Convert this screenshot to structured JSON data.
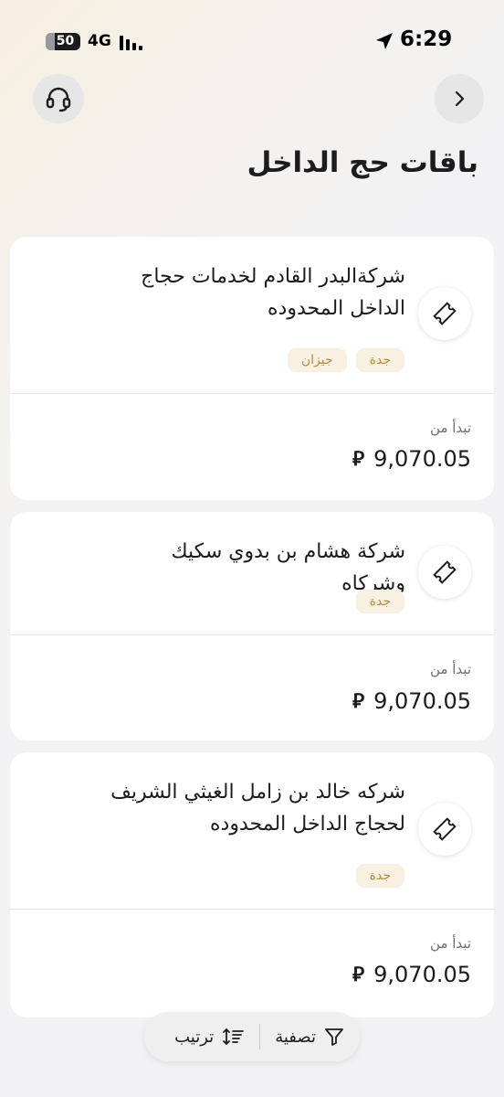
{
  "status_bar": {
    "time": "6:29",
    "battery": "50",
    "network": "4G",
    "icons": [
      "location-arrow-icon",
      "signal-bars-icon",
      "battery-icon"
    ]
  },
  "header": {
    "title": "باقات حج الداخل",
    "back_icon": "chevron-right-icon",
    "support_icon": "headset-icon"
  },
  "cards": [
    {
      "name": "شركةالبدر القادم لخدمات حجاج الداخل المحدوده",
      "tags": [
        "جدة",
        "جيزان"
      ],
      "from_label": "تبدأ من",
      "price": "9,070.05",
      "currency_symbol": "⃁"
    },
    {
      "name": "شركة هشام بن بدوي سكيك وشركاه",
      "tags": [
        "جدة"
      ],
      "from_label": "تبدأ من",
      "price": "9,070.05",
      "currency_symbol": "⃁"
    },
    {
      "name": "شركه خالد بن زامل الغيثي الشريف لحجاج الداخل المحدوده",
      "tags": [
        "جدة"
      ],
      "from_label": "تبدأ من",
      "price": "9,070.05",
      "currency_symbol": "⃁"
    }
  ],
  "bottom_bar": {
    "filter_label": "تصفية",
    "sort_label": "ترتيب",
    "filter_icon": "funnel-icon",
    "sort_icon": "sort-icon"
  },
  "colors": {
    "background": "#f2f2f4",
    "card": "#ffffff",
    "tag_bg": "#f8f1e2",
    "tag_text": "#b8893c",
    "muted_text": "#6e6e73"
  }
}
